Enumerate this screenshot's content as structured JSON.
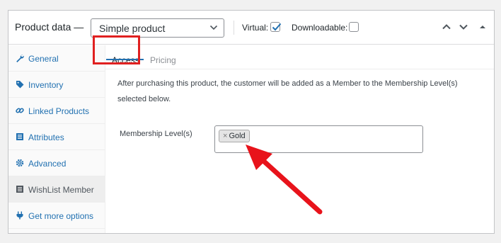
{
  "header": {
    "title": "Product data —",
    "product_type": "Simple product",
    "virtual_label": "Virtual:",
    "virtual_checked": true,
    "downloadable_label": "Downloadable:",
    "downloadable_checked": false
  },
  "sidebar": {
    "items": [
      {
        "label": "General",
        "icon": "wrench-icon"
      },
      {
        "label": "Inventory",
        "icon": "tag-icon"
      },
      {
        "label": "Linked Products",
        "icon": "link-icon"
      },
      {
        "label": "Attributes",
        "icon": "list-icon"
      },
      {
        "label": "Advanced",
        "icon": "gear-icon"
      },
      {
        "label": "WishList Member",
        "icon": "list-icon",
        "active": true
      },
      {
        "label": "Get more options",
        "icon": "plugin-icon"
      }
    ]
  },
  "tabs": [
    {
      "label": "Access",
      "active": true
    },
    {
      "label": "Pricing",
      "active": false
    }
  ],
  "content": {
    "description": "After purchasing this product, the customer will be added as a Member to the Membership Level(s) selected below.",
    "field_label": "Membership Level(s)",
    "selected_tokens": [
      "Gold"
    ],
    "token_remove_glyph": "×"
  },
  "colors": {
    "link_blue": "#2271b1",
    "highlight_red": "#e02020",
    "arrow_red": "#e8131b"
  }
}
